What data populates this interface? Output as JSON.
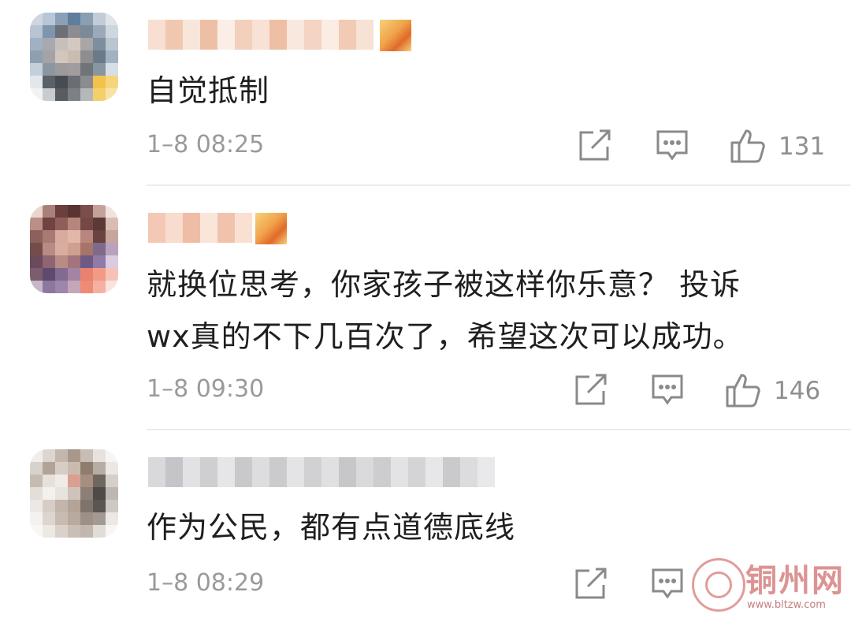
{
  "comments": [
    {
      "text": "自觉抵制",
      "time": "1–8 08:25",
      "likes": "131"
    },
    {
      "text_line1": "就换位思考，你家孩子被这样你乐意？ 投诉",
      "text_line2": "wx真的不下几百次了，希望这次可以成功。",
      "time": "1–8 09:30",
      "likes": "146"
    },
    {
      "text": "作为公民，都有点道德底线",
      "time": "1–8 08:29",
      "likes": ""
    }
  ],
  "icons": {
    "share": "share-icon",
    "comment": "comment-icon",
    "like": "thumbs-up-icon"
  },
  "colors": {
    "text": "#1f1f1f",
    "meta": "#9a9a9a",
    "watermark": "#c84d4d"
  },
  "watermark": {
    "name": "铜州网",
    "url": "www.bltzw.com"
  }
}
